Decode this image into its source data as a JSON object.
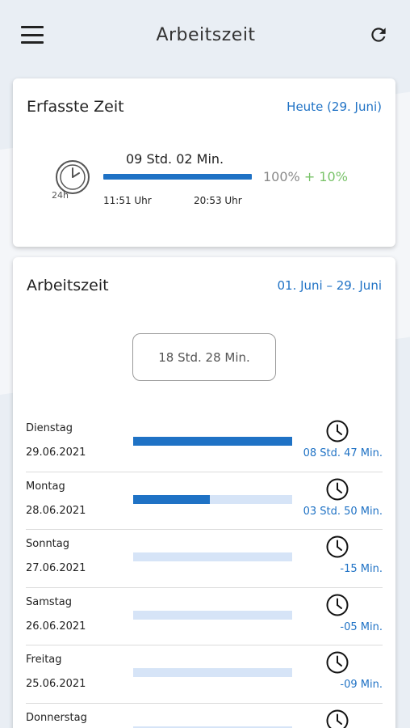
{
  "app_bar": {
    "title": "Arbeitszeit",
    "menu_icon": "hamburger-menu-icon",
    "refresh_icon": "refresh-icon"
  },
  "summary_card": {
    "title": "Erfasste Zeit",
    "date": "Heute (29. Juni)",
    "duration": "09 Std. 02 Min.",
    "start": "11:51 Uhr",
    "end": "20:53 Uhr",
    "percent": "100%",
    "percent_plus": "+ 10%",
    "progress_fraction": 1.0,
    "icon": "clock-24h-icon"
  },
  "work_card": {
    "title": "Arbeitszeit",
    "range": "01. Juni – 29. Juni",
    "total": "18 Std. 28 Min.",
    "days": [
      {
        "name": "Dienstag",
        "date": "29.06.2021",
        "duration": "08 Std. 47 Min.",
        "fraction": 1.0
      },
      {
        "name": "Montag",
        "date": "28.06.2021",
        "duration": "03 Std. 50 Min.",
        "fraction": 0.48
      },
      {
        "name": "Sonntag",
        "date": "27.06.2021",
        "duration": "-15 Min.",
        "fraction": 0
      },
      {
        "name": "Samstag",
        "date": "26.06.2021",
        "duration": "-05 Min.",
        "fraction": 0
      },
      {
        "name": "Freitag",
        "date": "25.06.2021",
        "duration": "-09 Min.",
        "fraction": 0
      },
      {
        "name": "Donnerstag",
        "date": "",
        "duration": "",
        "fraction": 0
      }
    ]
  },
  "colors": {
    "accent": "#1f72c5",
    "track": "#d6e4f7",
    "positive": "#7ac36a",
    "background": "#e9eef4"
  }
}
